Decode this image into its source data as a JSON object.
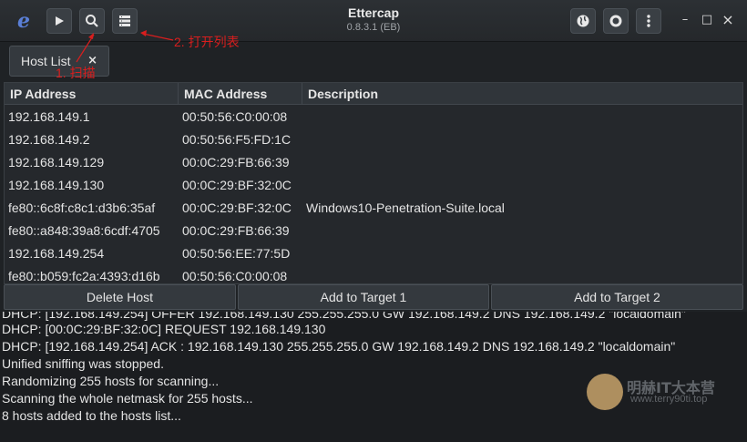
{
  "window": {
    "title": "Ettercap",
    "version": "0.8.3.1 (EB)",
    "logo_glyph": "e",
    "controls": {
      "minimize": "–",
      "maximize": "□",
      "close": "×"
    }
  },
  "toolbar": {
    "icons": [
      "play-icon",
      "search-icon",
      "host-list-icon"
    ],
    "right_icons": [
      "globe-icon",
      "record-icon",
      "menu-icon"
    ]
  },
  "annotations": {
    "step1": "1. 扫描",
    "step2": "2. 打开列表",
    "color": "#d81e1e"
  },
  "tab": {
    "label": "Host List",
    "close": "×"
  },
  "table": {
    "columns": [
      "IP Address",
      "MAC Address",
      "Description"
    ],
    "rows": [
      {
        "ip": "192.168.149.1",
        "mac": "00:50:56:C0:00:08",
        "desc": ""
      },
      {
        "ip": "192.168.149.2",
        "mac": "00:50:56:F5:FD:1C",
        "desc": ""
      },
      {
        "ip": "192.168.149.129",
        "mac": "00:0C:29:FB:66:39",
        "desc": ""
      },
      {
        "ip": "192.168.149.130",
        "mac": "00:0C:29:BF:32:0C",
        "desc": ""
      },
      {
        "ip": "fe80::6c8f:c8c1:d3b6:35af",
        "mac": "00:0C:29:BF:32:0C",
        "desc": "Windows10-Penetration-Suite.local"
      },
      {
        "ip": "fe80::a848:39a8:6cdf:4705",
        "mac": "00:0C:29:FB:66:39",
        "desc": ""
      },
      {
        "ip": "192.168.149.254",
        "mac": "00:50:56:EE:77:5D",
        "desc": ""
      },
      {
        "ip": "fe80::b059:fc2a:4393:d16b",
        "mac": "00:50:56:C0:00:08",
        "desc": ""
      }
    ]
  },
  "buttons": {
    "delete_host": "Delete Host",
    "add_target_1": "Add to Target 1",
    "add_target_2": "Add to Target 2"
  },
  "log": [
    "DHCP: [192.168.149.254] OFFER 192.168.149.130 255.255.255.0 GW 192.168.149.2 DNS 192.168.149.2 \"localdomain\"",
    "DHCP: [00:0C:29:BF:32:0C] REQUEST 192.168.149.130",
    "DHCP: [192.168.149.254] ACK : 192.168.149.130 255.255.255.0 GW 192.168.149.2 DNS 192.168.149.2 \"localdomain\"",
    "Unified sniffing was stopped.",
    "Randomizing 255 hosts for scanning...",
    "Scanning the whole netmask for 255 hosts...",
    "8 hosts added to the hosts list..."
  ],
  "watermark": {
    "name": "明赫IT大本营",
    "url": "www.terry90ti.top"
  }
}
